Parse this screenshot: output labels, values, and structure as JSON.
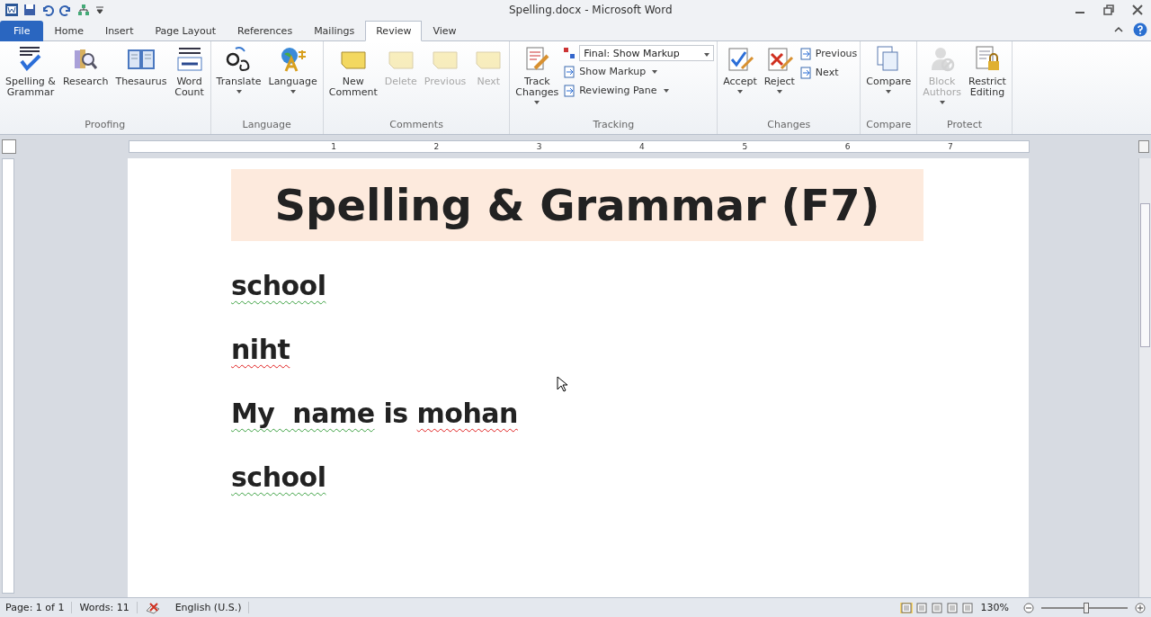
{
  "window": {
    "title": "Spelling.docx  -  Microsoft Word"
  },
  "tabs": [
    {
      "label": "File",
      "kind": "file",
      "selected": false
    },
    {
      "label": "Home",
      "kind": "tab",
      "selected": false
    },
    {
      "label": "Insert",
      "kind": "tab",
      "selected": false
    },
    {
      "label": "Page Layout",
      "kind": "tab",
      "selected": false
    },
    {
      "label": "References",
      "kind": "tab",
      "selected": false
    },
    {
      "label": "Mailings",
      "kind": "tab",
      "selected": false
    },
    {
      "label": "Review",
      "kind": "tab",
      "selected": true
    },
    {
      "label": "View",
      "kind": "tab",
      "selected": false
    }
  ],
  "ribbon": [
    {
      "name": "Proofing",
      "items": [
        {
          "kind": "big",
          "label": "Spelling &\nGrammar",
          "disabled": false
        },
        {
          "kind": "big",
          "label": "Research",
          "disabled": false
        },
        {
          "kind": "big",
          "label": "Thesaurus",
          "disabled": false
        },
        {
          "kind": "big",
          "label": "Word\nCount",
          "disabled": false
        }
      ]
    },
    {
      "name": "Language",
      "items": [
        {
          "kind": "big",
          "label": "Translate",
          "dropdown": true,
          "disabled": false
        },
        {
          "kind": "big",
          "label": "Language",
          "dropdown": true,
          "disabled": false
        }
      ]
    },
    {
      "name": "Comments",
      "items": [
        {
          "kind": "big",
          "label": "New\nComment",
          "disabled": false
        },
        {
          "kind": "big",
          "label": "Delete",
          "disabled": true
        },
        {
          "kind": "big",
          "label": "Previous",
          "disabled": true
        },
        {
          "kind": "big",
          "label": "Next",
          "disabled": true
        }
      ]
    },
    {
      "name": "Tracking",
      "items": [
        {
          "kind": "big",
          "label": "Track\nChanges",
          "dropdown": true,
          "disabled": false
        },
        {
          "kind": "stack",
          "rows": [
            {
              "kind": "select",
              "value": "Final: Show Markup"
            },
            {
              "kind": "small",
              "label": "Show Markup",
              "dropdown": true
            },
            {
              "kind": "small",
              "label": "Reviewing Pane",
              "dropdown": true
            }
          ]
        }
      ]
    },
    {
      "name": "Changes",
      "items": [
        {
          "kind": "big",
          "label": "Accept",
          "dropdown": true,
          "disabled": false
        },
        {
          "kind": "big",
          "label": "Reject",
          "dropdown": true,
          "disabled": false
        },
        {
          "kind": "stack",
          "rows": [
            {
              "kind": "small",
              "label": "Previous",
              "dropdown": false
            },
            {
              "kind": "small",
              "label": "Next",
              "dropdown": false
            }
          ]
        }
      ]
    },
    {
      "name": "Compare",
      "items": [
        {
          "kind": "big",
          "label": "Compare",
          "dropdown": true,
          "disabled": false
        }
      ]
    },
    {
      "name": "Protect",
      "items": [
        {
          "kind": "big",
          "label": "Block\nAuthors",
          "dropdown": true,
          "disabled": true
        },
        {
          "kind": "big",
          "label": "Restrict\nEditing",
          "disabled": false
        }
      ]
    }
  ],
  "ruler": {
    "ticks": [
      "1",
      "2",
      "3",
      "4",
      "5",
      "6",
      "7"
    ]
  },
  "document": {
    "heading": "Spelling & Grammar (F7)",
    "lines": [
      [
        {
          "text": "school",
          "kind": "grammar"
        }
      ],
      [
        {
          "text": "niht",
          "kind": "spelling"
        }
      ],
      [
        {
          "text": "My  name",
          "kind": "grammar"
        },
        {
          "text": " is ",
          "kind": "plain"
        },
        {
          "text": "mohan",
          "kind": "spelling"
        }
      ],
      [
        {
          "text": "school",
          "kind": "grammar"
        }
      ]
    ]
  },
  "status_bar": {
    "page": "Page: 1 of 1",
    "words": "Words: 11",
    "language": "English (U.S.)",
    "zoom": "130%",
    "zoom_level": {
      "level": 0.52
    }
  }
}
